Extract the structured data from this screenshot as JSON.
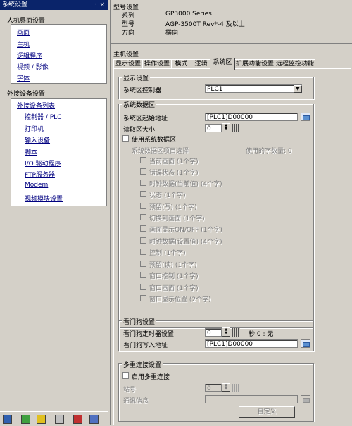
{
  "left_panel": {
    "title": "系统设置",
    "pin_glyph": "ꟷ",
    "close_glyph": "×",
    "hmi_group": {
      "title": "人机界面设置",
      "items": [
        "画面",
        "主机",
        "逻辑程序",
        "视频 / 影像",
        "字体"
      ]
    },
    "device_group": {
      "title": "外接设备设置",
      "items": [
        "外接设备列表",
        "控制器 / PLC",
        "打印机",
        "输入设备",
        "脚本",
        "I/O 驱动程序",
        "FTP服务器",
        "Modem",
        "视频模块设置"
      ]
    }
  },
  "model": {
    "heading": "型号设置",
    "series_label": "系列",
    "series_value": "GP3000 Series",
    "model_label": "型号",
    "model_value": "AGP-3500T  Rev*-4 及以上",
    "orient_label": "方向",
    "orient_value": "横向"
  },
  "main": {
    "heading": "主机设置",
    "tabs": [
      "显示设置",
      "操作设置",
      "模式",
      "逻辑",
      "系统区",
      "扩展功能设置",
      "远程监控功能"
    ],
    "active_tab": "系统区"
  },
  "display_group": {
    "title": "显示设置",
    "controller_label": "系统区控制器",
    "controller_value": "PLC1"
  },
  "system_data": {
    "title": "系统数据区",
    "start_addr_label": "系统区起始地址",
    "start_addr_value": "[PLC1]D00000",
    "read_size_label": "读取区大小",
    "read_size_value": "0",
    "use_area_label": "使用系统数据区",
    "item_select_label": "系统数据区项目选择",
    "word_count_label": "使用的字数量: 0",
    "items": [
      "当前画面 (1个字)",
      "错误状态 (1个字)",
      "时钟数据(当前值) (4个字)",
      "状态 (1个字)",
      "预留(写) (1个字)",
      "切换到画面 (1个字)",
      "画面显示ON/OFF (1个字)",
      "时钟数据(设置值) (4个字)",
      "控制 (1个字)",
      "预留(读) (1个字)",
      "窗口控制 (1个字)",
      "窗口画面 (1个字)",
      "窗口显示位置 (2个字)"
    ]
  },
  "watchdog": {
    "title": "看门狗设置",
    "timer_label": "看门狗定时器设置",
    "timer_value": "0",
    "sec_label": "秒 0 : 无",
    "write_addr_label": "看门狗写入地址",
    "write_addr_value": "[PLC1]D00000"
  },
  "multi": {
    "title": "多重连接设置",
    "enable_label": "启用多重连接",
    "station_label": "站号",
    "station_value": "0",
    "comm_label": "通讯信息",
    "comm_value": "",
    "custom_button": "自定义"
  },
  "colors": {
    "title_bar": "#0a246a",
    "link": "#000080",
    "face": "#d4d0c8"
  },
  "icons": [
    "pin-icon",
    "close-icon",
    "dropdown-arrow-icon",
    "spinner-icon",
    "keypad-icon",
    "address-browse-icon"
  ]
}
